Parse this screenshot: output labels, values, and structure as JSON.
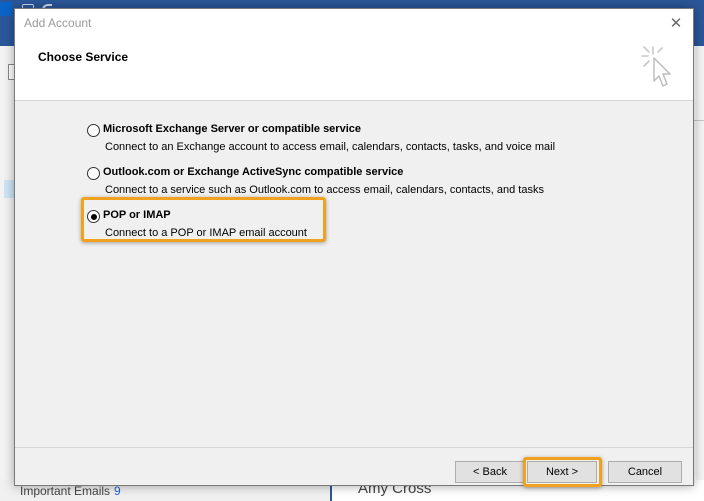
{
  "background": {
    "important_label": "Important Emails",
    "important_count": "9",
    "reading_name": "Amy Cross"
  },
  "dialog": {
    "title": "Add Account",
    "close_icon": "close-icon",
    "header_title": "Choose Service",
    "header_icon": "wizard-cursor-icon",
    "options": [
      {
        "label": "Microsoft Exchange Server or compatible service",
        "description": "Connect to an Exchange account to access email, calendars, contacts, tasks, and voice mail",
        "selected": false
      },
      {
        "label": "Outlook.com or Exchange ActiveSync compatible service",
        "description": "Connect to a service such as Outlook.com to access email, calendars, contacts, and tasks",
        "selected": false
      },
      {
        "label": "POP or IMAP",
        "description": "Connect to a POP or IMAP email account",
        "selected": true
      }
    ],
    "buttons": {
      "back": "< Back",
      "next": "Next >",
      "cancel": "Cancel"
    }
  },
  "colors": {
    "highlight": "#f0a21f",
    "outlook_blue": "#2b579a"
  }
}
